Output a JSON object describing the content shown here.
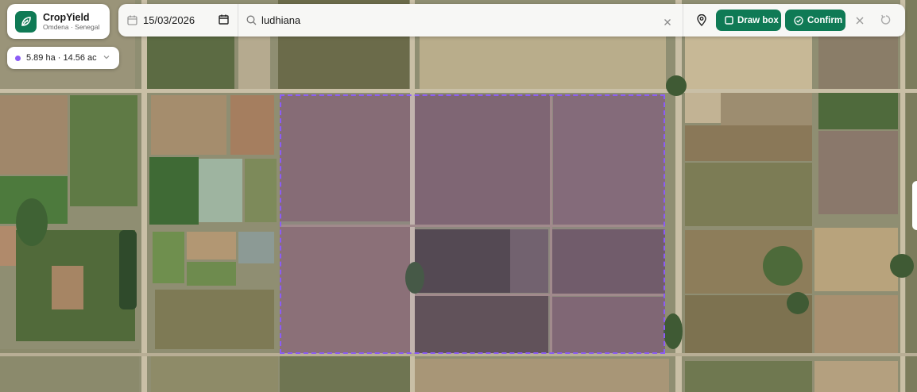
{
  "brand": {
    "title": "CropYield",
    "subtitle": "Omdena · Senegal",
    "accent": "#0f7a55",
    "icon": "leaf-icon"
  },
  "area": {
    "label": "5.89 ha · 14.56 ac",
    "dot_color": "#8b5cf6"
  },
  "toolbar": {
    "date_value": "15/03/2026",
    "search_value": "ludhiana",
    "draw_label": "Draw box",
    "confirm_label": "Confirm"
  },
  "selection": {
    "color": "#8b5cf6"
  }
}
